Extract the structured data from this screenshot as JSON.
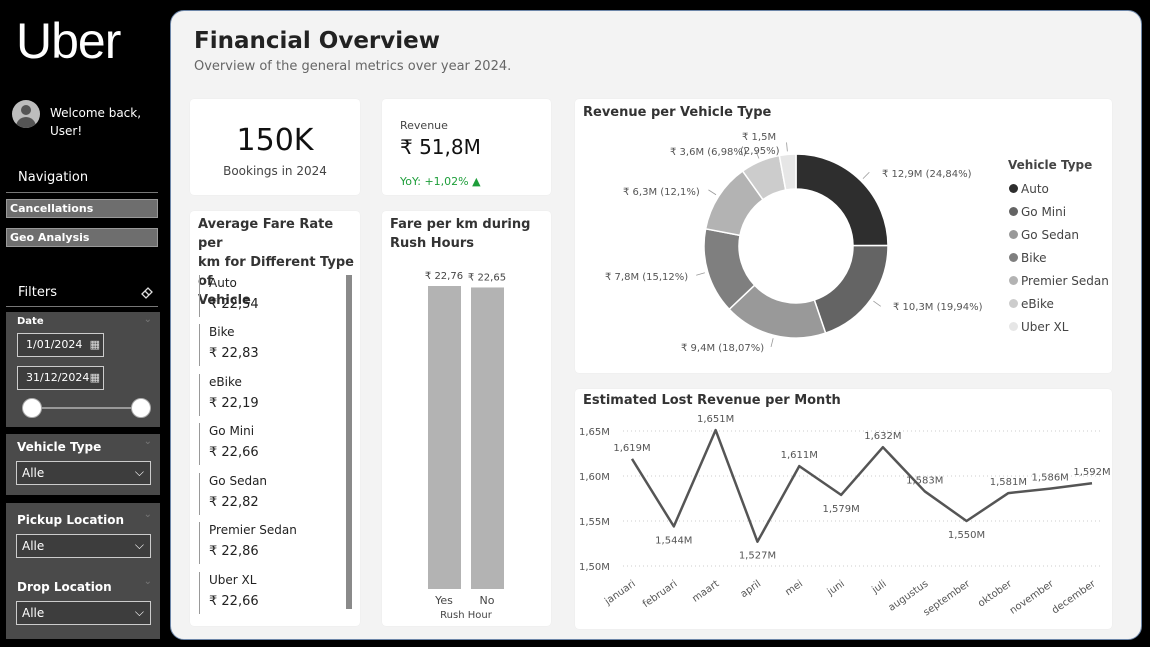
{
  "sidebar": {
    "logo": "Uber",
    "welcome_line1": "Welcome back,",
    "welcome_line2": "User!",
    "navigation_title": "Navigation",
    "nav_items": [
      {
        "label": "Cancellations"
      },
      {
        "label": "Geo Analysis"
      }
    ],
    "filters_title": "Filters",
    "date_filter": {
      "label": "Date",
      "start": "1/01/2024",
      "end": "31/12/2024"
    },
    "vehicle_type_filter": {
      "label": "Vehicle Type",
      "value": "Alle"
    },
    "pickup_filter": {
      "label": "Pickup Location",
      "value": "Alle"
    },
    "drop_filter": {
      "label": "Drop Location",
      "value": "Alle"
    }
  },
  "header": {
    "title": "Financial Overview",
    "subtitle": "Overview of the general metrics over year 2024."
  },
  "kpis": {
    "bookings": {
      "value": "150K",
      "label": "Bookings in 2024"
    },
    "revenue": {
      "label": "Revenue",
      "value": "₹ 51,8M",
      "yoy": "YoY: +1,02% ▲"
    }
  },
  "colors": {
    "positive": "#1e9e3a",
    "accent": "#2d2d2d"
  },
  "fare_rate": {
    "title_line1": "Average Fare Rate per",
    "title_line2": "km for Different Type of",
    "title_line3": "Vehicle",
    "items": [
      {
        "name": "Auto",
        "value": "₹ 22,54"
      },
      {
        "name": "Bike",
        "value": "₹ 22,83"
      },
      {
        "name": "eBike",
        "value": "₹ 22,19"
      },
      {
        "name": "Go Mini",
        "value": "₹ 22,66"
      },
      {
        "name": "Go Sedan",
        "value": "₹ 22,82"
      },
      {
        "name": "Premier Sedan",
        "value": "₹ 22,86"
      },
      {
        "name": "Uber XL",
        "value": "₹ 22,66"
      }
    ]
  },
  "chart_data": [
    {
      "type": "bar",
      "title": "Fare per km during Rush Hours",
      "xlabel": "Rush Hour",
      "categories": [
        "Yes",
        "No"
      ],
      "values": [
        22.76,
        22.65
      ],
      "data_labels": [
        "₹ 22,76",
        "₹ 22,65"
      ]
    },
    {
      "type": "pie",
      "title": "Revenue per Vehicle Type",
      "legend_title": "Vehicle Type",
      "legend_position": "right",
      "categories": [
        "Auto",
        "Go Mini",
        "Go Sedan",
        "Bike",
        "Premier Sedan",
        "eBike",
        "Uber XL"
      ],
      "values": [
        12.9,
        10.3,
        9.4,
        7.8,
        6.3,
        3.6,
        1.5
      ],
      "percentages": [
        24.84,
        19.94,
        18.07,
        15.12,
        12.1,
        6.98,
        2.95
      ],
      "data_labels": [
        "₹ 12,9M (24,84%)",
        "₹ 10,3M (19,94%)",
        "₹ 9,4M (18,07%)",
        "₹ 7,8M (15,12%)",
        "₹ 6,3M (12,1%)",
        "₹ 3,6M (6,98%)",
        "₹ 1,5M (2,95%)"
      ],
      "colors": [
        "#2e2e2e",
        "#646464",
        "#999999",
        "#7f7f7f",
        "#b3b3b3",
        "#cccccc",
        "#e6e6e6"
      ]
    },
    {
      "type": "line",
      "title": "Estimated Lost Revenue per Month",
      "categories": [
        "januari",
        "februari",
        "maart",
        "april",
        "mei",
        "juni",
        "juli",
        "augustus",
        "september",
        "oktober",
        "november",
        "december"
      ],
      "values": [
        1.619,
        1.544,
        1.651,
        1.527,
        1.611,
        1.579,
        1.632,
        1.583,
        1.55,
        1.581,
        1.586,
        1.592
      ],
      "data_labels": [
        "1,619M",
        "1,544M",
        "1,651M",
        "1,527M",
        "1,611M",
        "1,579M",
        "1,632M",
        "1,583M",
        "1,550M",
        "1,581M",
        "1,586M",
        "1,592M"
      ],
      "ylim": [
        1.5,
        1.65
      ],
      "yticks": [
        "1,50M",
        "1,55M",
        "1,60M",
        "1,65M"
      ],
      "ytick_values": [
        1.5,
        1.55,
        1.6,
        1.65
      ],
      "grid": true
    }
  ]
}
